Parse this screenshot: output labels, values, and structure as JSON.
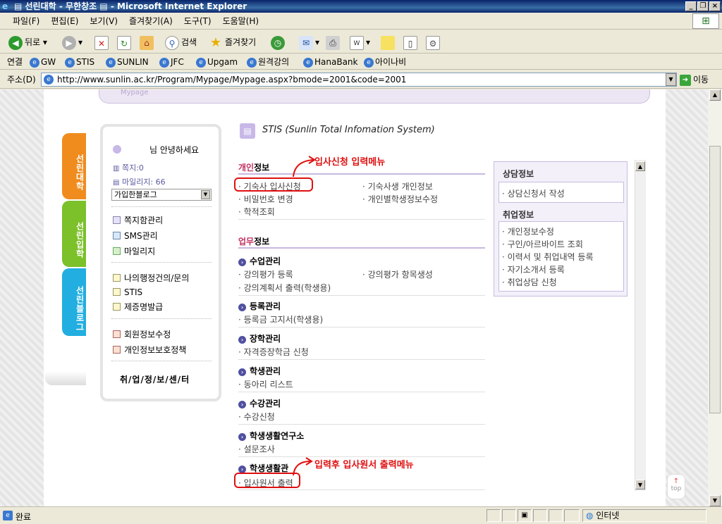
{
  "window": {
    "title": "▤ 선린대학 - 무한창조 ▤ - Microsoft Internet Explorer"
  },
  "menu": [
    "파일(F)",
    "편집(E)",
    "보기(V)",
    "즐겨찾기(A)",
    "도구(T)",
    "도움말(H)"
  ],
  "toolbar": {
    "back": "뒤로",
    "search": "검색",
    "favorites": "즐겨찾기"
  },
  "links": {
    "label": "연결",
    "items": [
      "GW",
      "STIS",
      "SUNLIN",
      "JFC",
      "Upgam",
      "원격강의",
      "HanaBank",
      "아이나비"
    ]
  },
  "address": {
    "label": "주소(D)",
    "url": "http://www.sunlin.ac.kr/Program/Mypage/Mypage.aspx?bmode=2001&code=2001",
    "go": "이동"
  },
  "page": {
    "breadcrumb": "Mypage",
    "side_tabs": [
      "선린대학",
      "선린입학",
      "선린블로그"
    ],
    "login": {
      "greeting": "님 안녕하세요",
      "messages": "쪽지:0",
      "mileage": "마일리지: 66",
      "blog_select": "가입한블로그",
      "menu1": [
        "쪽지함관리",
        "SMS관리",
        "마일리지"
      ],
      "menu2": [
        "나의행정건의/문의",
        "STIS",
        "제증명발급"
      ],
      "menu3": [
        "회원정보수정",
        "개인정보보호정책"
      ],
      "job_center": "취/업/정/보/센/터"
    },
    "stis_title": "STIS (Sunlin Total Infomation System)",
    "personal": {
      "title_a": "개인",
      "title_b": "정보",
      "col1": [
        "기숙사 입사신청",
        "비밀번호 변경",
        "학적조회"
      ],
      "col2": [
        "기숙사생 개인정보",
        "개인별학생정보수정"
      ]
    },
    "work": {
      "title_a": "업무",
      "title_b": "정보",
      "categories": [
        {
          "name": "수업관리",
          "items": [
            "강의평가 등록",
            "강의계획서 출력(학생용)"
          ],
          "items2": [
            "강의평가 항목생성"
          ]
        },
        {
          "name": "등록관리",
          "items": [
            "등록금 고지서(학생용)"
          ]
        },
        {
          "name": "장학관리",
          "items": [
            "자격증장학금 신청"
          ]
        },
        {
          "name": "학생관리",
          "items": [
            "동아리 리스트"
          ]
        },
        {
          "name": "수강관리",
          "items": [
            "수강신청"
          ]
        },
        {
          "name": "학생생활연구소",
          "items": [
            "설문조사"
          ]
        },
        {
          "name": "학생생활관",
          "items": [
            "입사원서 출력"
          ]
        }
      ]
    },
    "counsel": {
      "title": "상담정보",
      "items": [
        "상담신청서 작성"
      ]
    },
    "job": {
      "title": "취업정보",
      "items": [
        "개인정보수정",
        "구인/아르바이트 조회",
        "이력서 및 취업내역 등록",
        "자기소개서 등록",
        "취업상담 신청"
      ]
    },
    "annotations": [
      "입사신청 입력메뉴",
      "입력후 입사원서 출력메뉴"
    ],
    "top_button": "top"
  },
  "status": {
    "text": "완료",
    "zone": "인터넷"
  }
}
